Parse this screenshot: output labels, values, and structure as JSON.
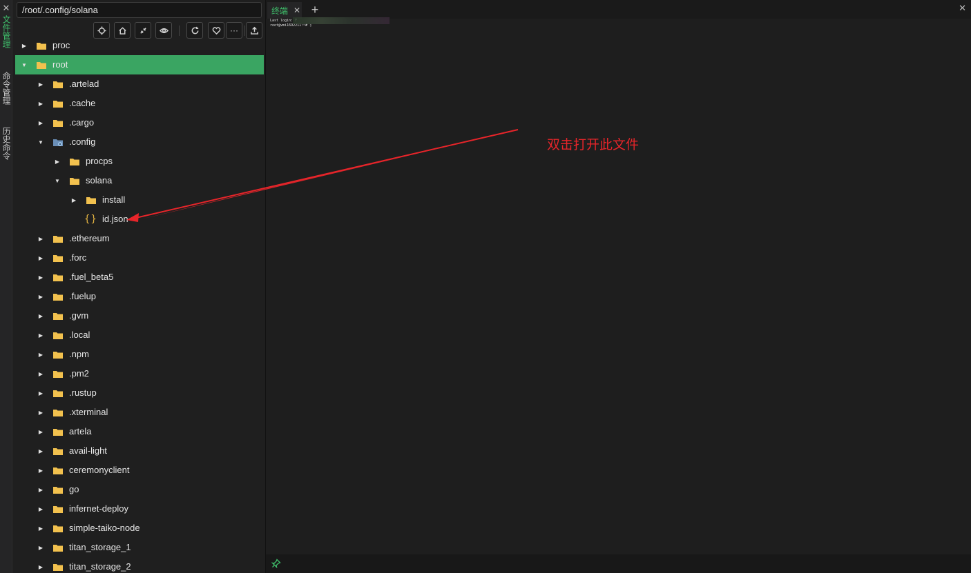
{
  "rail": {
    "close": "✕",
    "tabs": [
      "文件管理",
      "命令管理",
      "历史命令"
    ]
  },
  "file_panel": {
    "path": "/root/.config/solana",
    "toolbar": {
      "more_label": "···"
    },
    "tree": [
      {
        "label": "proc",
        "depth": 0,
        "state": "collapsed",
        "type": "folder"
      },
      {
        "label": "root",
        "depth": 0,
        "state": "expanded",
        "type": "folder",
        "selected": true
      },
      {
        "label": ".artelad",
        "depth": 1,
        "state": "collapsed",
        "type": "folder"
      },
      {
        "label": ".cache",
        "depth": 1,
        "state": "collapsed",
        "type": "folder"
      },
      {
        "label": ".cargo",
        "depth": 1,
        "state": "collapsed",
        "type": "folder"
      },
      {
        "label": ".config",
        "depth": 1,
        "state": "expanded",
        "type": "config-folder"
      },
      {
        "label": "procps",
        "depth": 2,
        "state": "collapsed",
        "type": "folder"
      },
      {
        "label": "solana",
        "depth": 2,
        "state": "expanded",
        "type": "folder"
      },
      {
        "label": "install",
        "depth": 3,
        "state": "collapsed",
        "type": "folder"
      },
      {
        "label": "id.json",
        "depth": 3,
        "state": "none",
        "type": "json"
      },
      {
        "label": ".ethereum",
        "depth": 1,
        "state": "collapsed",
        "type": "folder"
      },
      {
        "label": ".forc",
        "depth": 1,
        "state": "collapsed",
        "type": "folder"
      },
      {
        "label": ".fuel_beta5",
        "depth": 1,
        "state": "collapsed",
        "type": "folder"
      },
      {
        "label": ".fuelup",
        "depth": 1,
        "state": "collapsed",
        "type": "folder"
      },
      {
        "label": ".gvm",
        "depth": 1,
        "state": "collapsed",
        "type": "folder"
      },
      {
        "label": ".local",
        "depth": 1,
        "state": "collapsed",
        "type": "folder"
      },
      {
        "label": ".npm",
        "depth": 1,
        "state": "collapsed",
        "type": "folder"
      },
      {
        "label": ".pm2",
        "depth": 1,
        "state": "collapsed",
        "type": "folder"
      },
      {
        "label": ".rustup",
        "depth": 1,
        "state": "collapsed",
        "type": "folder"
      },
      {
        "label": ".xterminal",
        "depth": 1,
        "state": "collapsed",
        "type": "folder"
      },
      {
        "label": "artela",
        "depth": 1,
        "state": "collapsed",
        "type": "folder"
      },
      {
        "label": "avail-light",
        "depth": 1,
        "state": "collapsed",
        "type": "folder"
      },
      {
        "label": "ceremonyclient",
        "depth": 1,
        "state": "collapsed",
        "type": "folder"
      },
      {
        "label": "go",
        "depth": 1,
        "state": "collapsed",
        "type": "folder"
      },
      {
        "label": "infernet-deploy",
        "depth": 1,
        "state": "collapsed",
        "type": "folder"
      },
      {
        "label": "simple-taiko-node",
        "depth": 1,
        "state": "collapsed",
        "type": "folder"
      },
      {
        "label": "titan_storage_1",
        "depth": 1,
        "state": "collapsed",
        "type": "folder"
      },
      {
        "label": "titan_storage_2",
        "depth": 1,
        "state": "collapsed",
        "type": "folder"
      }
    ]
  },
  "terminal": {
    "tab_label": "终端",
    "tab_close": "✕",
    "add_tab": "+",
    "panel_close": "✕",
    "lines": [
      "Last login: F",
      "root@vmi1692211:~# ▯"
    ]
  },
  "annotation": {
    "text": "双击打开此文件",
    "color": "#e8252a"
  },
  "colors": {
    "selected_row": "#3aa562",
    "accent_green": "#3fbf6b",
    "folder": "#f2c14e",
    "json_icon": "#e3b341"
  }
}
